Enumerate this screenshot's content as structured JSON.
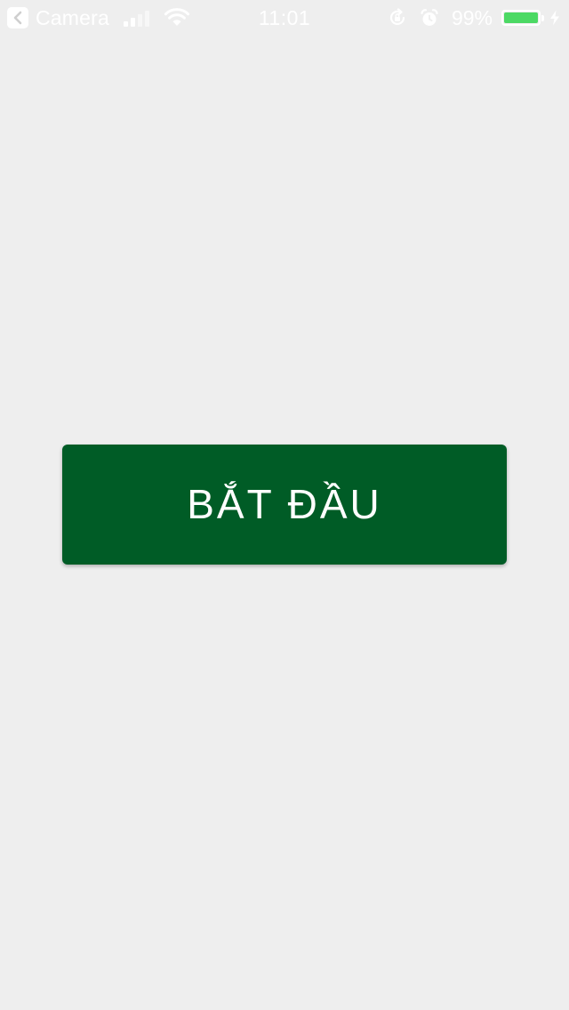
{
  "status_bar": {
    "back_app_label": "Camera",
    "time": "11:01",
    "battery_percent": "99%",
    "battery_level": 0.99,
    "signal_bars_active": 2,
    "signal_bars_total": 4,
    "icons": {
      "back": "chevron-left-icon",
      "signal": "cellular-signal-icon",
      "wifi": "wifi-icon",
      "rotation_lock": "rotation-lock-icon",
      "alarm": "alarm-clock-icon",
      "battery": "battery-icon",
      "charging": "charging-bolt-icon"
    },
    "colors": {
      "text": "#ffffff",
      "battery_fill": "#4cd964"
    }
  },
  "main": {
    "start_button_label": "BẮT ĐẦU"
  },
  "colors": {
    "background": "#eeeeee",
    "button_background": "#005c26",
    "button_text": "#ffffff"
  }
}
